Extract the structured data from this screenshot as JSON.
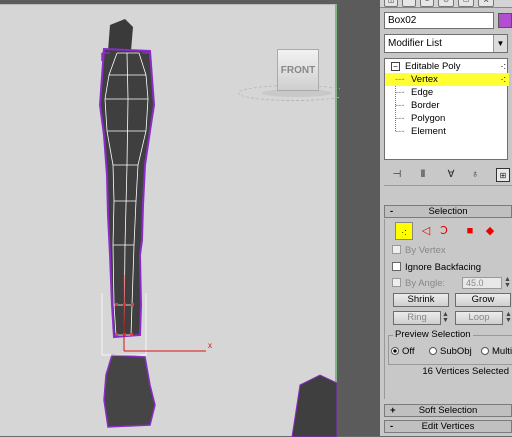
{
  "viewport": {
    "viewcube_label": "FRONT",
    "gizmo_axis_label": "x"
  },
  "panel": {
    "object_name": "Box02",
    "object_color": "#b24fd1",
    "modifier_list": "Modifier List",
    "stack": {
      "items": [
        {
          "label": "Editable Poly",
          "expand": "⊟",
          "selected": false
        },
        {
          "label": "Vertex",
          "selected": true
        },
        {
          "label": "Edge",
          "selected": false
        },
        {
          "label": "Border",
          "selected": false
        },
        {
          "label": "Polygon",
          "selected": false
        },
        {
          "label": "Element",
          "selected": false
        }
      ]
    },
    "selection": {
      "title": "Selection",
      "sign": "-",
      "by_vertex": "By Vertex",
      "ignore_backfacing": "Ignore Backfacing",
      "by_angle": "By Angle:",
      "angle_value": "45.0",
      "shrink": "Shrink",
      "grow": "Grow",
      "ring": "Ring",
      "loop": "Loop",
      "preview_title": "Preview Selection",
      "preview_off": "Off",
      "preview_subobj": "SubObj",
      "preview_multi": "Multi",
      "status": "16 Vertices Selected"
    },
    "soft_selection": {
      "title": "Soft Selection",
      "sign": "+"
    },
    "edit_vertices": {
      "title": "Edit Vertices",
      "sign": "-"
    }
  }
}
